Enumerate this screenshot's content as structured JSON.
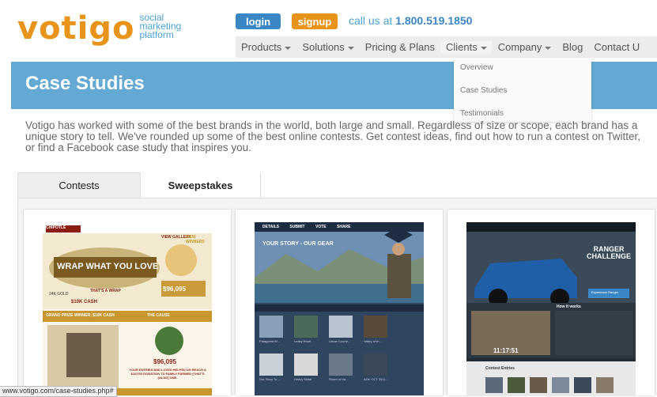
{
  "header": {
    "logo_text": "votigo",
    "logo_tagline": [
      "social",
      "marketing",
      "platform"
    ],
    "login_label": "login",
    "signup_label": "signup",
    "call_prefix": "call us at",
    "phone": "1.800.519.1850"
  },
  "nav": {
    "items": [
      {
        "label": "Products",
        "dropdown": true
      },
      {
        "label": "Solutions",
        "dropdown": true
      },
      {
        "label": "Pricing & Plans",
        "dropdown": false
      },
      {
        "label": "Clients",
        "dropdown": true
      },
      {
        "label": "Company",
        "dropdown": true
      },
      {
        "label": "Blog",
        "dropdown": false
      },
      {
        "label": "Contact U",
        "dropdown": false
      }
    ]
  },
  "clients_menu": {
    "items": [
      "Overview",
      "Case Studies",
      "Testimonials"
    ]
  },
  "page": {
    "title": "Case Studies",
    "intro": "Votigo has worked with some of the best brands in the world, both large and small. Regardless of size or scope, each brand has a unique story to tell. We've rounded up some of the best online contests. Get contest ideas, find out how to run a contest on Twitter, or find a Facebook case study that inspires you."
  },
  "tabs": [
    "Contests",
    "Sweepstakes"
  ],
  "cards": [
    {
      "logo": "CHIPOTLE",
      "links": [
        "VIEW GALLERY",
        "VIEW WINNERS"
      ],
      "headline": "WRAP WHAT YOU LOVE",
      "subhead": "THAT'S A WRAP",
      "amount": "$96,095",
      "cash": "$10K CASH",
      "gold": "24K GOLD",
      "grand_prize": "GRAND PRIZE WINNER: $10K CASH",
      "the_cause": "THE CAUSE",
      "cause_amount": "$96,095",
      "cause_text": "YOUR ENTRIES AND LOVES HELPED US REACH A $10,000 DONATION TO FAMILY FARMED (THAT'S [ALSO] ONE."
    },
    {
      "nav": [
        "DETAILS",
        "SUBMIT",
        "VOTE",
        "SHARE"
      ],
      "headline": "YOUR STORY - OUR GEAR",
      "photo_captions": [
        "Patagonia W...",
        "Leaky Roof!",
        "Urban Countr...",
        "Valley of th...",
        "Our Story To...",
        "Heavy Metal",
        "Storm in Ha...",
        "ADK OCT 2011..."
      ]
    },
    {
      "ranger_title": "RANGER CHALLENGE",
      "cta": "Experience Ranger",
      "how_it_works": "How it works",
      "time": "11:17:51",
      "entries_title": "Contest Entries"
    }
  ],
  "status_url": "www.votigo.com/case-studies.php#"
}
